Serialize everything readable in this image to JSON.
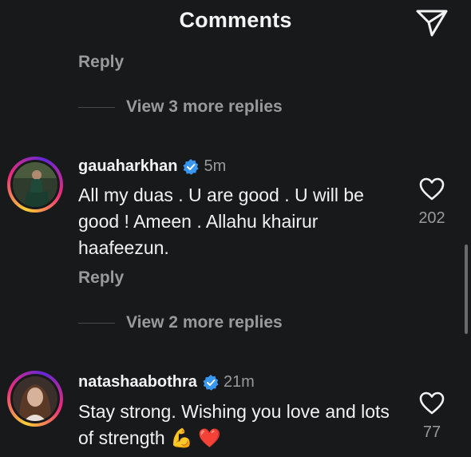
{
  "header": {
    "title": "Comments",
    "share_icon": "paper-plane-icon"
  },
  "top": {
    "reply_label": "Reply",
    "view_more": "View 3 more replies"
  },
  "comments": [
    {
      "username": "gauaharkhan",
      "time": "5m",
      "verified": true,
      "text": "All my duas . U are good . U will be good ! Ameen . Allahu khairur haafeezun.",
      "likes": "202",
      "reply_label": "Reply",
      "view_more": "View 2 more replies"
    },
    {
      "username": "natashaabothra",
      "time": "21m",
      "verified": true,
      "text": "Stay strong. Wishing you love and lots of strength",
      "emojis": "💪 ❤️",
      "likes": "77"
    }
  ],
  "colors": {
    "background": "#18191b",
    "verified_blue": "#3897f0",
    "muted": "#9a9a9a"
  }
}
